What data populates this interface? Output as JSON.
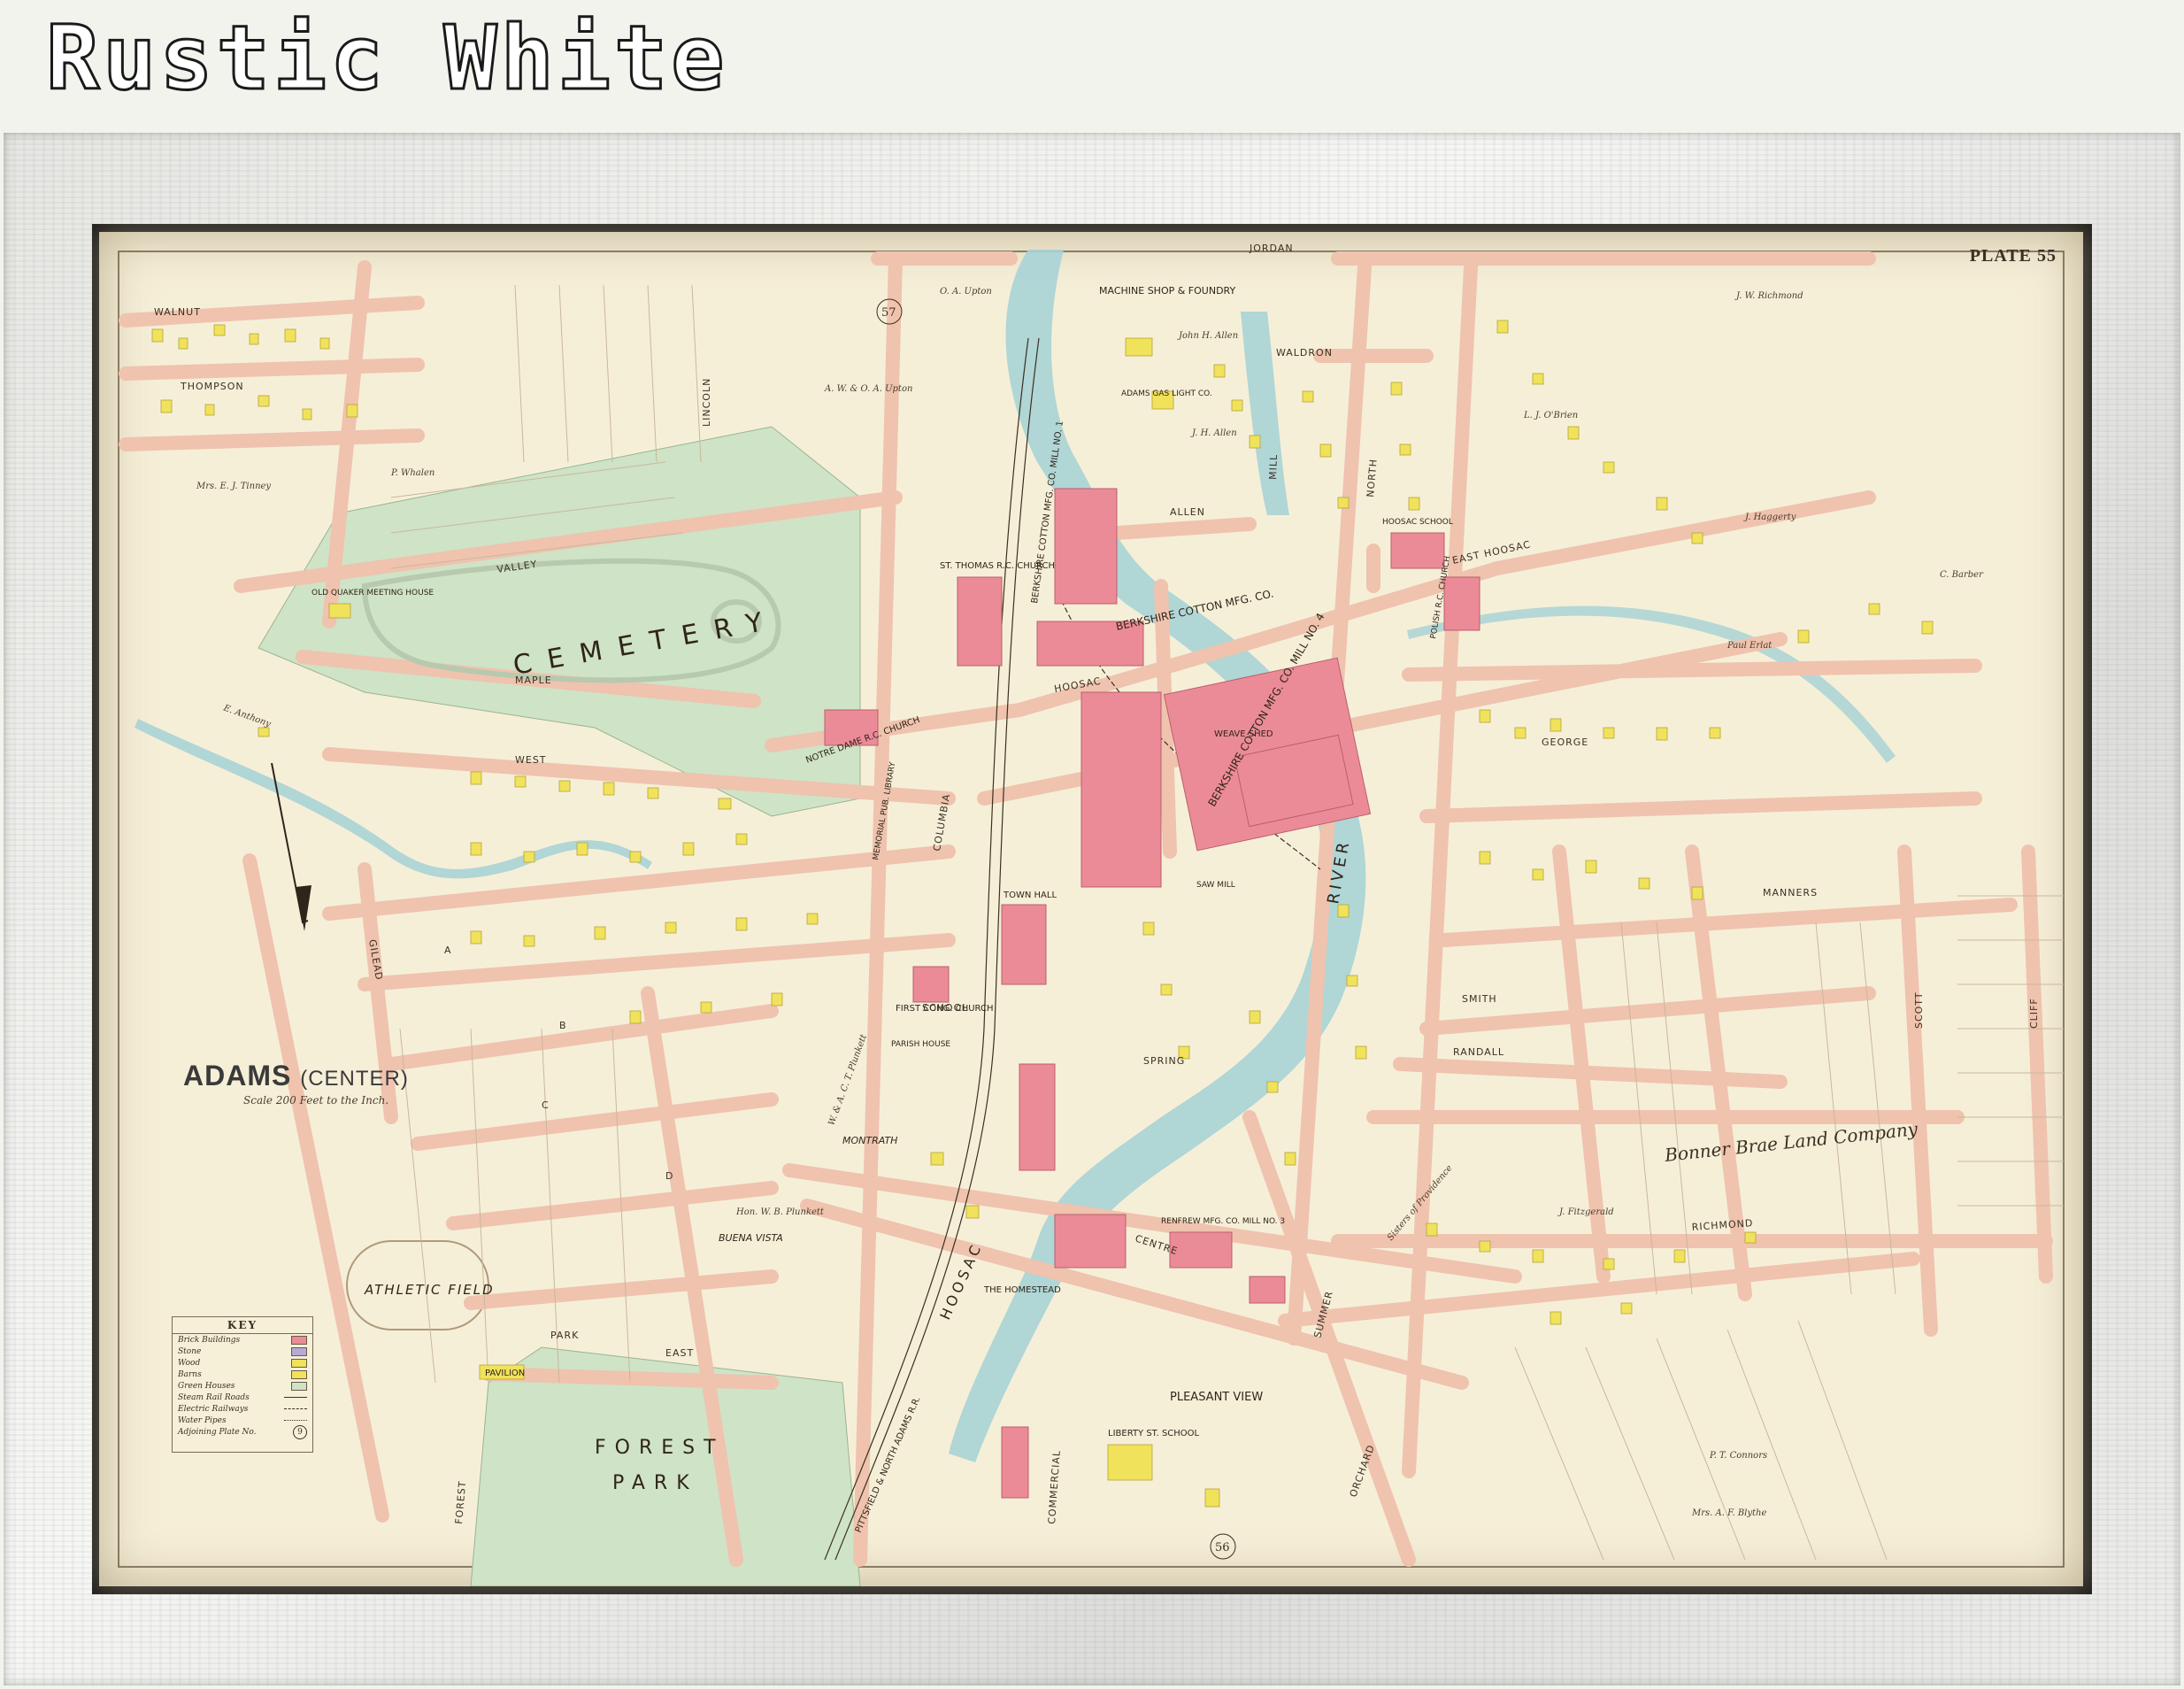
{
  "header": {
    "label": "Rustic White"
  },
  "map": {
    "plate": "PLATE 55",
    "title": "ADAMS",
    "title_suffix": "(CENTER)",
    "scale_note": "Scale 200 Feet to the Inch.",
    "adjoining_plates": [
      "57",
      "56"
    ],
    "colors": {
      "paper": "#f6efd8",
      "street": "#efc3ae",
      "brick": "#ec8b98",
      "wood": "#f0e25a",
      "green": "#cfe3c6",
      "river": "#a9d3d6"
    },
    "key": {
      "title": "KEY",
      "items": [
        {
          "label": "Brick Buildings",
          "symbol": "brick"
        },
        {
          "label": "Stone",
          "symbol": "stone"
        },
        {
          "label": "Wood",
          "symbol": "wood"
        },
        {
          "label": "Barns",
          "symbol": "barn"
        },
        {
          "label": "Green Houses",
          "symbol": "green"
        },
        {
          "label": "Steam Rail Roads",
          "symbol": "rail"
        },
        {
          "label": "Electric Railways",
          "symbol": "electric"
        },
        {
          "label": "Water Pipes",
          "symbol": "water"
        },
        {
          "label": "Adjoining Plate No.",
          "symbol": "plate",
          "value": "9"
        }
      ]
    },
    "areas": {
      "cemetery": "CEMETERY",
      "forest_park_1": "FOREST",
      "forest_park_2": "PARK",
      "athletic_field": "ATHLETIC FIELD",
      "pavilion": "PAVILION",
      "river": "RIVER",
      "pleasant_view": "PLEASANT VIEW",
      "bonner_brae": "Bonner Brae Land Company"
    },
    "streets": {
      "walnut": "WALNUT",
      "thompson": "THOMPSON",
      "valley": "VALLEY",
      "maple": "MAPLE",
      "west": "WEST",
      "gilead": "GILEAD",
      "a_st": "A",
      "b_st": "B",
      "c_st": "C",
      "d_st": "D",
      "park": "PARK",
      "east_ave": "EAST",
      "forest": "FOREST",
      "jordan": "JORDAN",
      "waldron": "WALDRON",
      "allen": "ALLEN",
      "east_hoosac": "EAST HOOSAC",
      "hoosac": "HOOSAC",
      "columbia": "COLUMBIA",
      "centre": "CENTRE",
      "summer": "SUMMER",
      "richmond": "RICHMOND",
      "north": "NORTH",
      "george": "GEORGE",
      "smith": "SMITH",
      "randall": "RANDALL",
      "manners": "MANNERS",
      "cliff": "CLIFF",
      "scott": "SCOTT",
      "orchard": "ORCHARD",
      "commercial": "COMMERCIAL",
      "lincoln": "LINCOLN",
      "mill": "MILL",
      "spring": "SPRING",
      "school": "SCHOOL"
    },
    "buildings": {
      "machine_shop": "MACHINE SHOP & FOUNDRY",
      "gas_light": "ADAMS GAS LIGHT CO.",
      "berkshire_1": "BERKSHIRE COTTON MFG. CO. MILL NO. 1",
      "berkshire_2": "BERKSHIRE COTTON MFG. CO.",
      "berkshire_4": "BERKSHIRE COTTON MFG. CO. MILL NO. 4",
      "berkshire_3": "BERKSHIRE COTTON MFG. CO. MILL NO. 3",
      "st_thomas": "ST. THOMAS R.C. CHURCH",
      "notre_dame": "NOTRE DAME R.C. CHURCH",
      "polish_church": "POLISH R.C. CHURCH",
      "hoosac_school": "HOOSAC SCHOOL",
      "town_hall": "TOWN HALL",
      "first_cong": "FIRST CONG. CHURCH",
      "memorial_library": "MEMORIAL PUB. LIBRARY",
      "renfrew": "RENFREW MFG. CO. MILL NO. 3",
      "liberty_school": "LIBERTY ST. SCHOOL",
      "saw_mill": "SAW MILL",
      "quaker": "OLD QUAKER MEETING HOUSE",
      "weave_shed": "WEAVE SHED",
      "parish_house": "PARISH HOUSE"
    },
    "owners": [
      "J. W. Richmond",
      "Mrs. E. J. Tinney",
      "A. W. & O. A. Upton",
      "O. A. Upton",
      "John H. Allen",
      "J. H. Allen",
      "E. Anthony",
      "P. Whalen",
      "L. J. O'Brien",
      "P. T. Connors",
      "Mrs. A. F. Blythe",
      "Hon. W. B. Plunkett",
      "W. & A. C. T. Plunkett",
      "J. Haggerty",
      "C. Barber",
      "Paul Erlat",
      "Sisters of Providence",
      "J. Fitzgerald"
    ],
    "numbers": [
      "57",
      "56"
    ],
    "estate_names": [
      "MONTRATH",
      "BUENA VISTA",
      "THE HOMESTEAD"
    ],
    "railroads": [
      "PITTSFIELD & NORTH ADAMS R.R.",
      "HOOSAC"
    ]
  }
}
